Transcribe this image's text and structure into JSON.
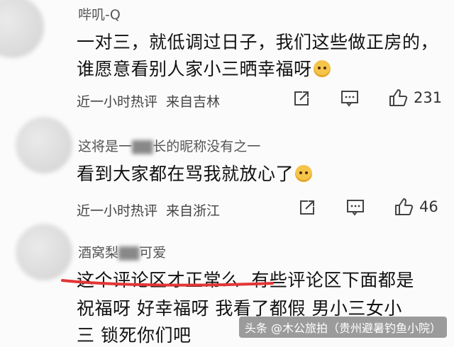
{
  "comments": [
    {
      "username": "哔叽-Q",
      "lines": [
        "一对三，就低调过日子，我们这些做正房的，",
        "谁愿意看别人家小三晒幸福呀"
      ],
      "meta_time": "近一小时热评",
      "meta_loc": "来自吉林",
      "likes": "231"
    },
    {
      "username_a": "这将是一",
      "username_b": "长的昵称没有之一",
      "lines": [
        "看到大家都在骂我就放心了"
      ],
      "meta_time": "近一小时热评",
      "meta_loc": "来自浙江",
      "likes": "46"
    },
    {
      "username_a": "酒窝梨",
      "username_b": "可爱",
      "line1_a": "这个评论区才正常么",
      "line1_b": "有些评论区下面都是",
      "line2": "祝福呀  好幸福呀  我看了都假  男小三女小",
      "line3": "三  锁死你们吧"
    }
  ],
  "watermark": "头条 @木公旅拍（贵州避暑钓鱼小院）",
  "colors": {
    "underline": "#e23636",
    "icon": "#444444"
  }
}
